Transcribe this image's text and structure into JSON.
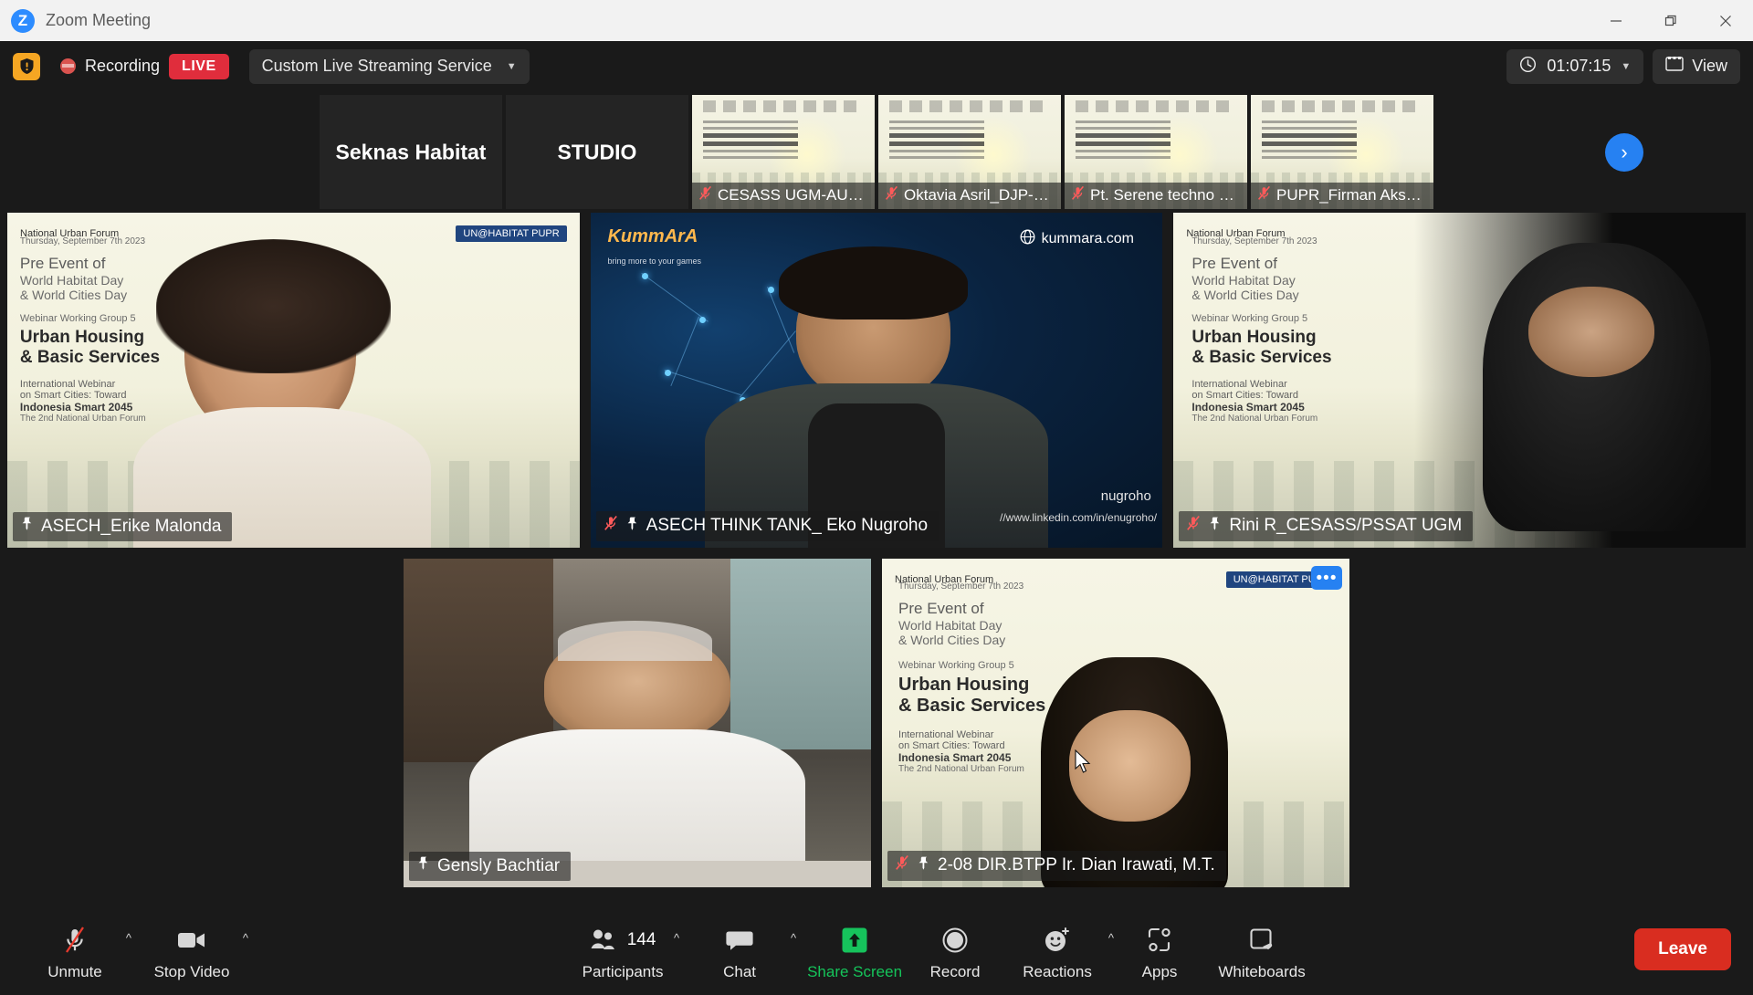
{
  "window": {
    "title": "Zoom Meeting",
    "logo_letter": "Z",
    "minimize_icon": "minimize-icon",
    "restore_icon": "restore-icon",
    "close_icon": "close-icon"
  },
  "topbar": {
    "shield_icon": "security-shield-icon",
    "recording_icon": "recording-indicator-icon",
    "recording_label": "Recording",
    "live_label": "LIVE",
    "stream_service": "Custom Live Streaming Service",
    "stream_caret_icon": "chevron-down-icon",
    "timer_icon": "clock-icon",
    "timer_value": "01:07:15",
    "timer_caret_icon": "chevron-down-icon",
    "view_icon": "grid-view-icon",
    "view_label": "View"
  },
  "filmstrip": {
    "next_icon": "chevron-right-icon",
    "thumbnails": [
      {
        "name": "Seknas Habitat",
        "avatar_text": "Seknas Habitat",
        "kind": "avatar",
        "muted": false
      },
      {
        "name": "STUDIO",
        "avatar_text": "STUDIO",
        "kind": "avatar",
        "muted": false
      },
      {
        "name": "CESASS UGM-AULIA",
        "kind": "poster",
        "muted": true,
        "mic_icon": "mic-muted-icon"
      },
      {
        "name": "Oktavia Asril_DJP-PUPR",
        "kind": "poster",
        "muted": true,
        "mic_icon": "mic-muted-icon"
      },
      {
        "name": "Pt. Serene techno bakt...",
        "kind": "poster",
        "muted": true,
        "mic_icon": "mic-muted-icon"
      },
      {
        "name": "PUPR_Firman Aksara",
        "kind": "poster",
        "muted": true,
        "mic_icon": "mic-muted-icon"
      }
    ]
  },
  "poster": {
    "date_line": "Thursday, September 7th 2023",
    "title_line1": "Pre Event of",
    "title_line2": "World Habitat Day",
    "title_line3": "& World Cities Day",
    "group_line": "Webinar Working Group 5",
    "heading1": "Urban Housing",
    "heading2": "& Basic Services",
    "sub1": "International Webinar",
    "sub2": "on Smart Cities: Toward",
    "sub3": "Indonesia Smart 2045",
    "sub4": "The 2nd National Urban Forum",
    "brand_left": "National Urban Forum",
    "brand_right": "UN@HABITAT  PUPR"
  },
  "videos": {
    "row1": [
      {
        "name": "ASECH_Erike Malonda",
        "pinned": true,
        "pin_icon": "pin-icon",
        "muted": false,
        "speaking": true,
        "background": "poster"
      },
      {
        "name": "ASECH THINK TANK_ Eko Nugroho",
        "pinned": true,
        "pin_icon": "pin-icon",
        "muted": true,
        "mic_icon": "mic-muted-icon",
        "speaking": false,
        "background": "constellation",
        "overlay_brand": "KummArA",
        "overlay_brand_sub": "bring more to your games",
        "overlay_site_icon": "globe-icon",
        "overlay_site": "kummara.com",
        "overlay_name": "nugroho",
        "overlay_link": "//www.linkedin.com/in/enugroho/"
      },
      {
        "name": "Rini R_CESASS/PSSAT UGM",
        "pinned": true,
        "pin_icon": "pin-icon",
        "muted": true,
        "mic_icon": "mic-muted-icon",
        "speaking": false,
        "background": "poster"
      }
    ],
    "row2": [
      {
        "name": "Gensly Bachtiar",
        "pinned": true,
        "pin_icon": "pin-icon",
        "muted": false,
        "speaking": false,
        "background": "room"
      },
      {
        "name": "2-08 DIR.BTPP Ir. Dian Irawati, M.T.",
        "pinned": true,
        "pin_icon": "pin-icon",
        "muted": true,
        "mic_icon": "mic-muted-icon",
        "speaking": false,
        "background": "poster",
        "more_label": "•••",
        "more_icon": "more-options-icon"
      }
    ]
  },
  "toolbar": {
    "unmute": {
      "label": "Unmute",
      "icon": "mic-muted-icon",
      "caret_icon": "chevron-up-icon"
    },
    "stop_video": {
      "label": "Stop Video",
      "icon": "video-camera-icon",
      "caret_icon": "chevron-up-icon"
    },
    "participants": {
      "label": "Participants",
      "icon": "people-icon",
      "count": "144",
      "caret_icon": "chevron-up-icon"
    },
    "chat": {
      "label": "Chat",
      "icon": "chat-bubble-icon",
      "caret_icon": "chevron-up-icon"
    },
    "share_screen": {
      "label": "Share Screen",
      "icon": "share-screen-icon"
    },
    "record": {
      "label": "Record",
      "icon": "record-circle-icon"
    },
    "reactions": {
      "label": "Reactions",
      "icon": "emoji-reaction-icon",
      "caret_icon": "chevron-up-icon"
    },
    "apps": {
      "label": "Apps",
      "icon": "apps-icon"
    },
    "whiteboards": {
      "label": "Whiteboards",
      "icon": "whiteboard-icon"
    },
    "leave": {
      "label": "Leave"
    }
  },
  "colors": {
    "accent_blue": "#2681f2",
    "live_red": "#e02d3c",
    "leave_red": "#d92d20",
    "share_green": "#15c45a",
    "speaking_border": "#f2f07a",
    "chrome_dark": "#1a1a1a"
  }
}
